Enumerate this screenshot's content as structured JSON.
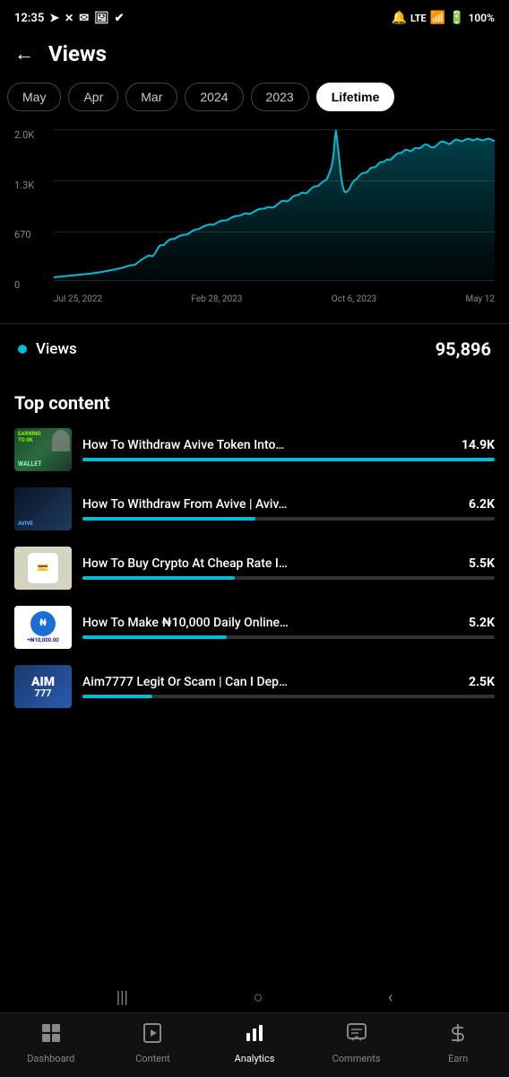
{
  "statusBar": {
    "time": "12:35",
    "icons_left": [
      "location-arrow",
      "x-logo",
      "mail",
      "image",
      "checkmark-circle"
    ],
    "icons_right": [
      "bell-slash",
      "lte",
      "signal",
      "battery"
    ],
    "battery": "100%"
  },
  "header": {
    "back_label": "←",
    "title": "Views"
  },
  "periodFilter": {
    "options": [
      "May",
      "Apr",
      "Mar",
      "2024",
      "2023",
      "Lifetime"
    ],
    "active": "Lifetime"
  },
  "chart": {
    "y_labels": [
      "2.0K",
      "1.3K",
      "670",
      "0"
    ],
    "x_labels": [
      "Jul 25, 2022",
      "Feb 28, 2023",
      "Oct 6, 2023",
      "May 12"
    ],
    "accent_color": "#00bcd4"
  },
  "viewsLegend": {
    "label": "Views",
    "count": "95,896",
    "dot_color": "#00bcd4"
  },
  "topContent": {
    "sectionTitle": "Top content",
    "items": [
      {
        "title": "How To Withdraw Avive Token Into…",
        "views": "14.9K",
        "progress": 100,
        "thumb_label": "TO 0K\nWALLET"
      },
      {
        "title": "How To Withdraw From Avive | Aviv…",
        "views": "6.2K",
        "progress": 42,
        "thumb_label": ""
      },
      {
        "title": "How To Buy Crypto At Cheap Rate I…",
        "views": "5.5K",
        "progress": 37,
        "thumb_label": ""
      },
      {
        "title": "How To Make ₦10,000 Daily Online…",
        "views": "5.2K",
        "progress": 35,
        "thumb_label": "+₦10,000.00"
      },
      {
        "title": "Aim7777 Legit Or Scam | Can I Dep…",
        "views": "2.5K",
        "progress": 17,
        "thumb_label": "AIM\n777"
      }
    ]
  },
  "bottomNav": {
    "items": [
      {
        "id": "dashboard",
        "label": "Dashboard",
        "icon": "grid"
      },
      {
        "id": "content",
        "label": "Content",
        "icon": "play-square"
      },
      {
        "id": "analytics",
        "label": "Analytics",
        "icon": "bar-chart"
      },
      {
        "id": "comments",
        "label": "Comments",
        "icon": "chat-square"
      },
      {
        "id": "earn",
        "label": "Earn",
        "icon": "dollar"
      }
    ],
    "active": "analytics"
  },
  "systemNav": {
    "buttons": [
      "|||",
      "○",
      "<"
    ]
  }
}
